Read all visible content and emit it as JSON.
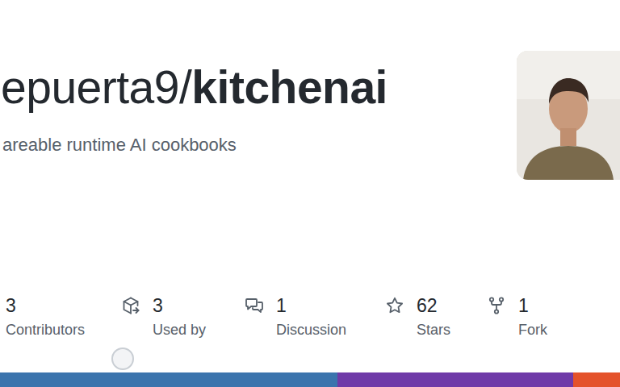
{
  "repo": {
    "owner": "epuerta9/",
    "name": "kitchenai",
    "description": "areable runtime AI cookbooks"
  },
  "stats": [
    {
      "value": "3",
      "label": "Contributors",
      "kind": "contributors"
    },
    {
      "value": "3",
      "label": "Used by",
      "kind": "used-by"
    },
    {
      "value": "1",
      "label": "Discussion",
      "kind": "discussion"
    },
    {
      "value": "62",
      "label": "Stars",
      "kind": "stars"
    },
    {
      "value": "1",
      "label": "Fork",
      "kind": "fork"
    }
  ],
  "languages": [
    {
      "level": 0.544,
      "color": "#3b74ad"
    },
    {
      "level": 0.38,
      "color": "#6f3aa8"
    },
    {
      "level": 0.076,
      "color": "#e4522b"
    }
  ]
}
